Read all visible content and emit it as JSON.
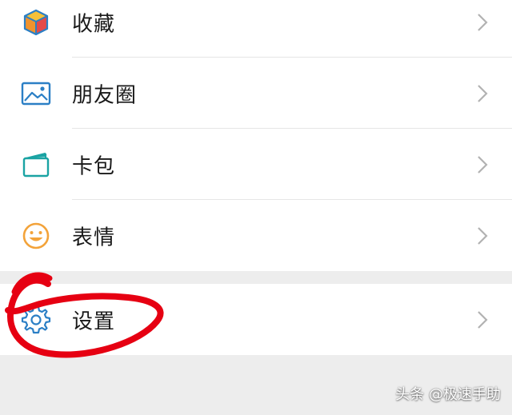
{
  "menu_top": [
    {
      "label": "收藏",
      "icon": "favorites-cube-icon"
    },
    {
      "label": "朋友圈",
      "icon": "moments-image-icon"
    },
    {
      "label": "卡包",
      "icon": "card-wallet-icon"
    },
    {
      "label": "表情",
      "icon": "sticker-smiley-icon"
    }
  ],
  "menu_bottom": [
    {
      "label": "设置",
      "icon": "gear-icon"
    }
  ],
  "watermark": "头条 @极速手助",
  "colors": {
    "background": "#ededed",
    "row_bg": "#ffffff",
    "text": "#191919",
    "chevron": "#b2b2b2",
    "highlight_circle": "#e60012",
    "icon_blue": "#2b7fc5",
    "icon_orange": "#f3a33a",
    "icon_teal": "#1aa3a3"
  }
}
